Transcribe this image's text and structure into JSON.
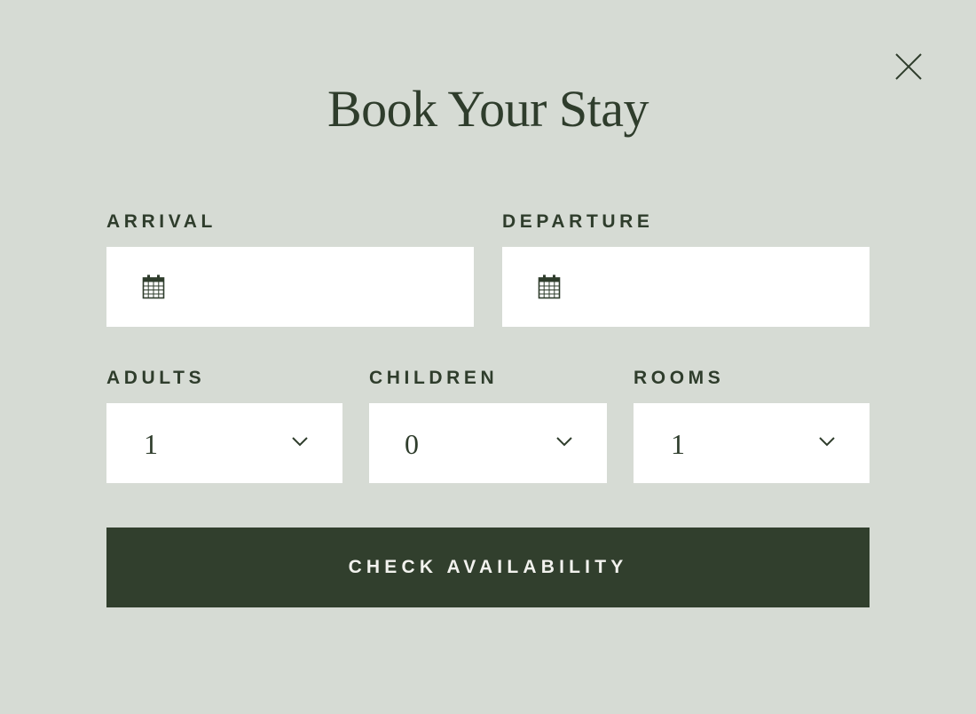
{
  "modal": {
    "title": "Book Your Stay",
    "close_icon": "close-icon"
  },
  "arrival": {
    "label": "ARRIVAL",
    "icon": "calendar-icon",
    "value": ""
  },
  "departure": {
    "label": "DEPARTURE",
    "icon": "calendar-icon",
    "value": ""
  },
  "adults": {
    "label": "ADULTS",
    "value": "1",
    "icon": "chevron-down-icon"
  },
  "children": {
    "label": "CHILDREN",
    "value": "0",
    "icon": "chevron-down-icon"
  },
  "rooms": {
    "label": "ROOMS",
    "value": "1",
    "icon": "chevron-down-icon"
  },
  "cta": {
    "label": "CHECK AVAILABILITY"
  },
  "colors": {
    "background": "#d6dbd4",
    "text": "#2f3d2c",
    "field_background": "#ffffff",
    "button_background": "#313f2d",
    "button_text": "#f2f2ee"
  }
}
